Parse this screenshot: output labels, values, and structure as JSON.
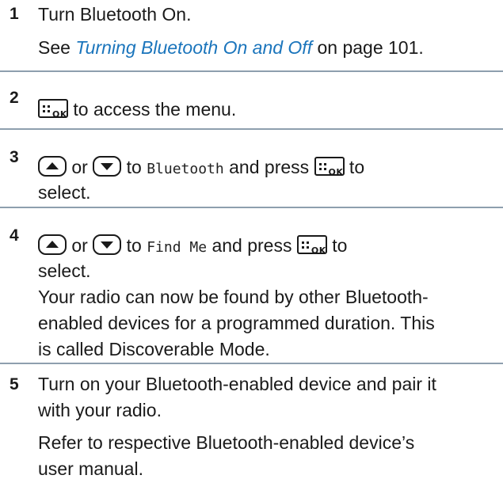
{
  "steps": [
    {
      "number": "1",
      "line1": "Turn Bluetooth On.",
      "see_prefix": "See ",
      "see_link": "Turning Bluetooth On and Off",
      "see_suffix": " on page 101."
    },
    {
      "number": "2",
      "after_key": " to access the menu."
    },
    {
      "number": "3",
      "or_word": " or ",
      "to_word": " to ",
      "menu_item": "Bluetooth",
      "press_text": " and press ",
      "to_word2": " to",
      "line2": "select."
    },
    {
      "number": "4",
      "or_word": " or ",
      "to_word": " to ",
      "menu_item": "Find Me",
      "press_text": " and press ",
      "to_word2": " to",
      "line2": "select.",
      "desc1": "Your radio can now be found by other Bluetooth-",
      "desc2": "enabled devices for a programmed duration. This",
      "desc3": "is called Discoverable Mode."
    },
    {
      "number": "5",
      "line1": "Turn on your Bluetooth-enabled device and pair it",
      "line2": "with your radio.",
      "ref1": "Refer to respective Bluetooth-enabled device’s",
      "ref2": "user manual."
    }
  ],
  "icons": {
    "menu_ok_key": "menu-ok-key-icon",
    "up_arrow_key": "up-arrow-key-icon",
    "down_arrow_key": "down-arrow-key-icon",
    "ok_text": "OK"
  }
}
